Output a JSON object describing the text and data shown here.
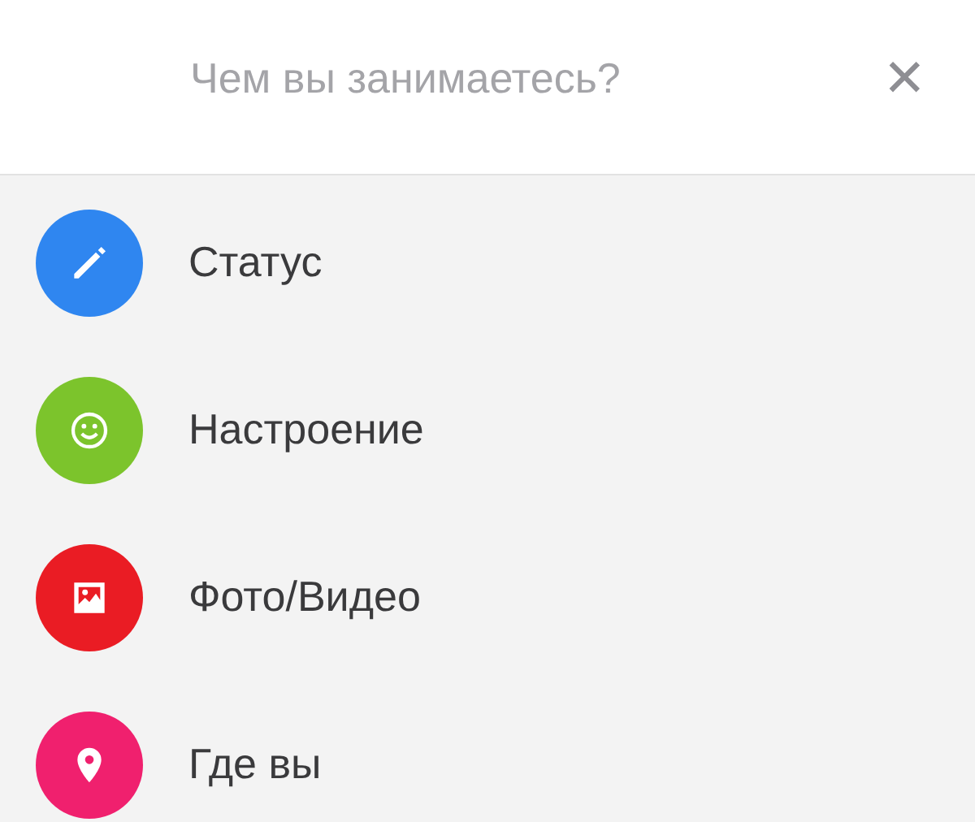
{
  "composer": {
    "placeholder": "Чем вы занимаетесь?",
    "close": "✕"
  },
  "options": [
    {
      "kind": "pencil",
      "label": "Статус",
      "color": "#2f86f0"
    },
    {
      "kind": "smiley",
      "label": "Настроение",
      "color": "#7cc42c"
    },
    {
      "kind": "photo",
      "label": "Фото/Видео",
      "color": "#ea1c24"
    },
    {
      "kind": "pin",
      "label": "Где вы",
      "color": "#f0206e"
    }
  ]
}
